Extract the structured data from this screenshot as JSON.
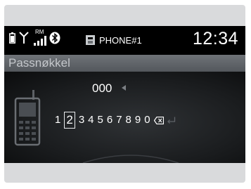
{
  "status_bar": {
    "roaming_label": "RM",
    "phone_name": "PHONE#1",
    "clock": "12:34",
    "icons": [
      "battery-icon",
      "signal-icon",
      "bluetooth-icon",
      "phone-icon"
    ]
  },
  "title": "Passnøkkel",
  "passkey_entry": "000",
  "keypad": {
    "keys": [
      "1",
      "2",
      "3",
      "4",
      "5",
      "6",
      "7",
      "8",
      "9",
      "0"
    ],
    "selected_key": "2",
    "icons": [
      "backspace-icon",
      "enter-icon"
    ]
  },
  "colors": {
    "screen_bg": "#000000",
    "title_bar": "#5f6368",
    "text": "#ffffff",
    "muted": "#7b7f84"
  }
}
